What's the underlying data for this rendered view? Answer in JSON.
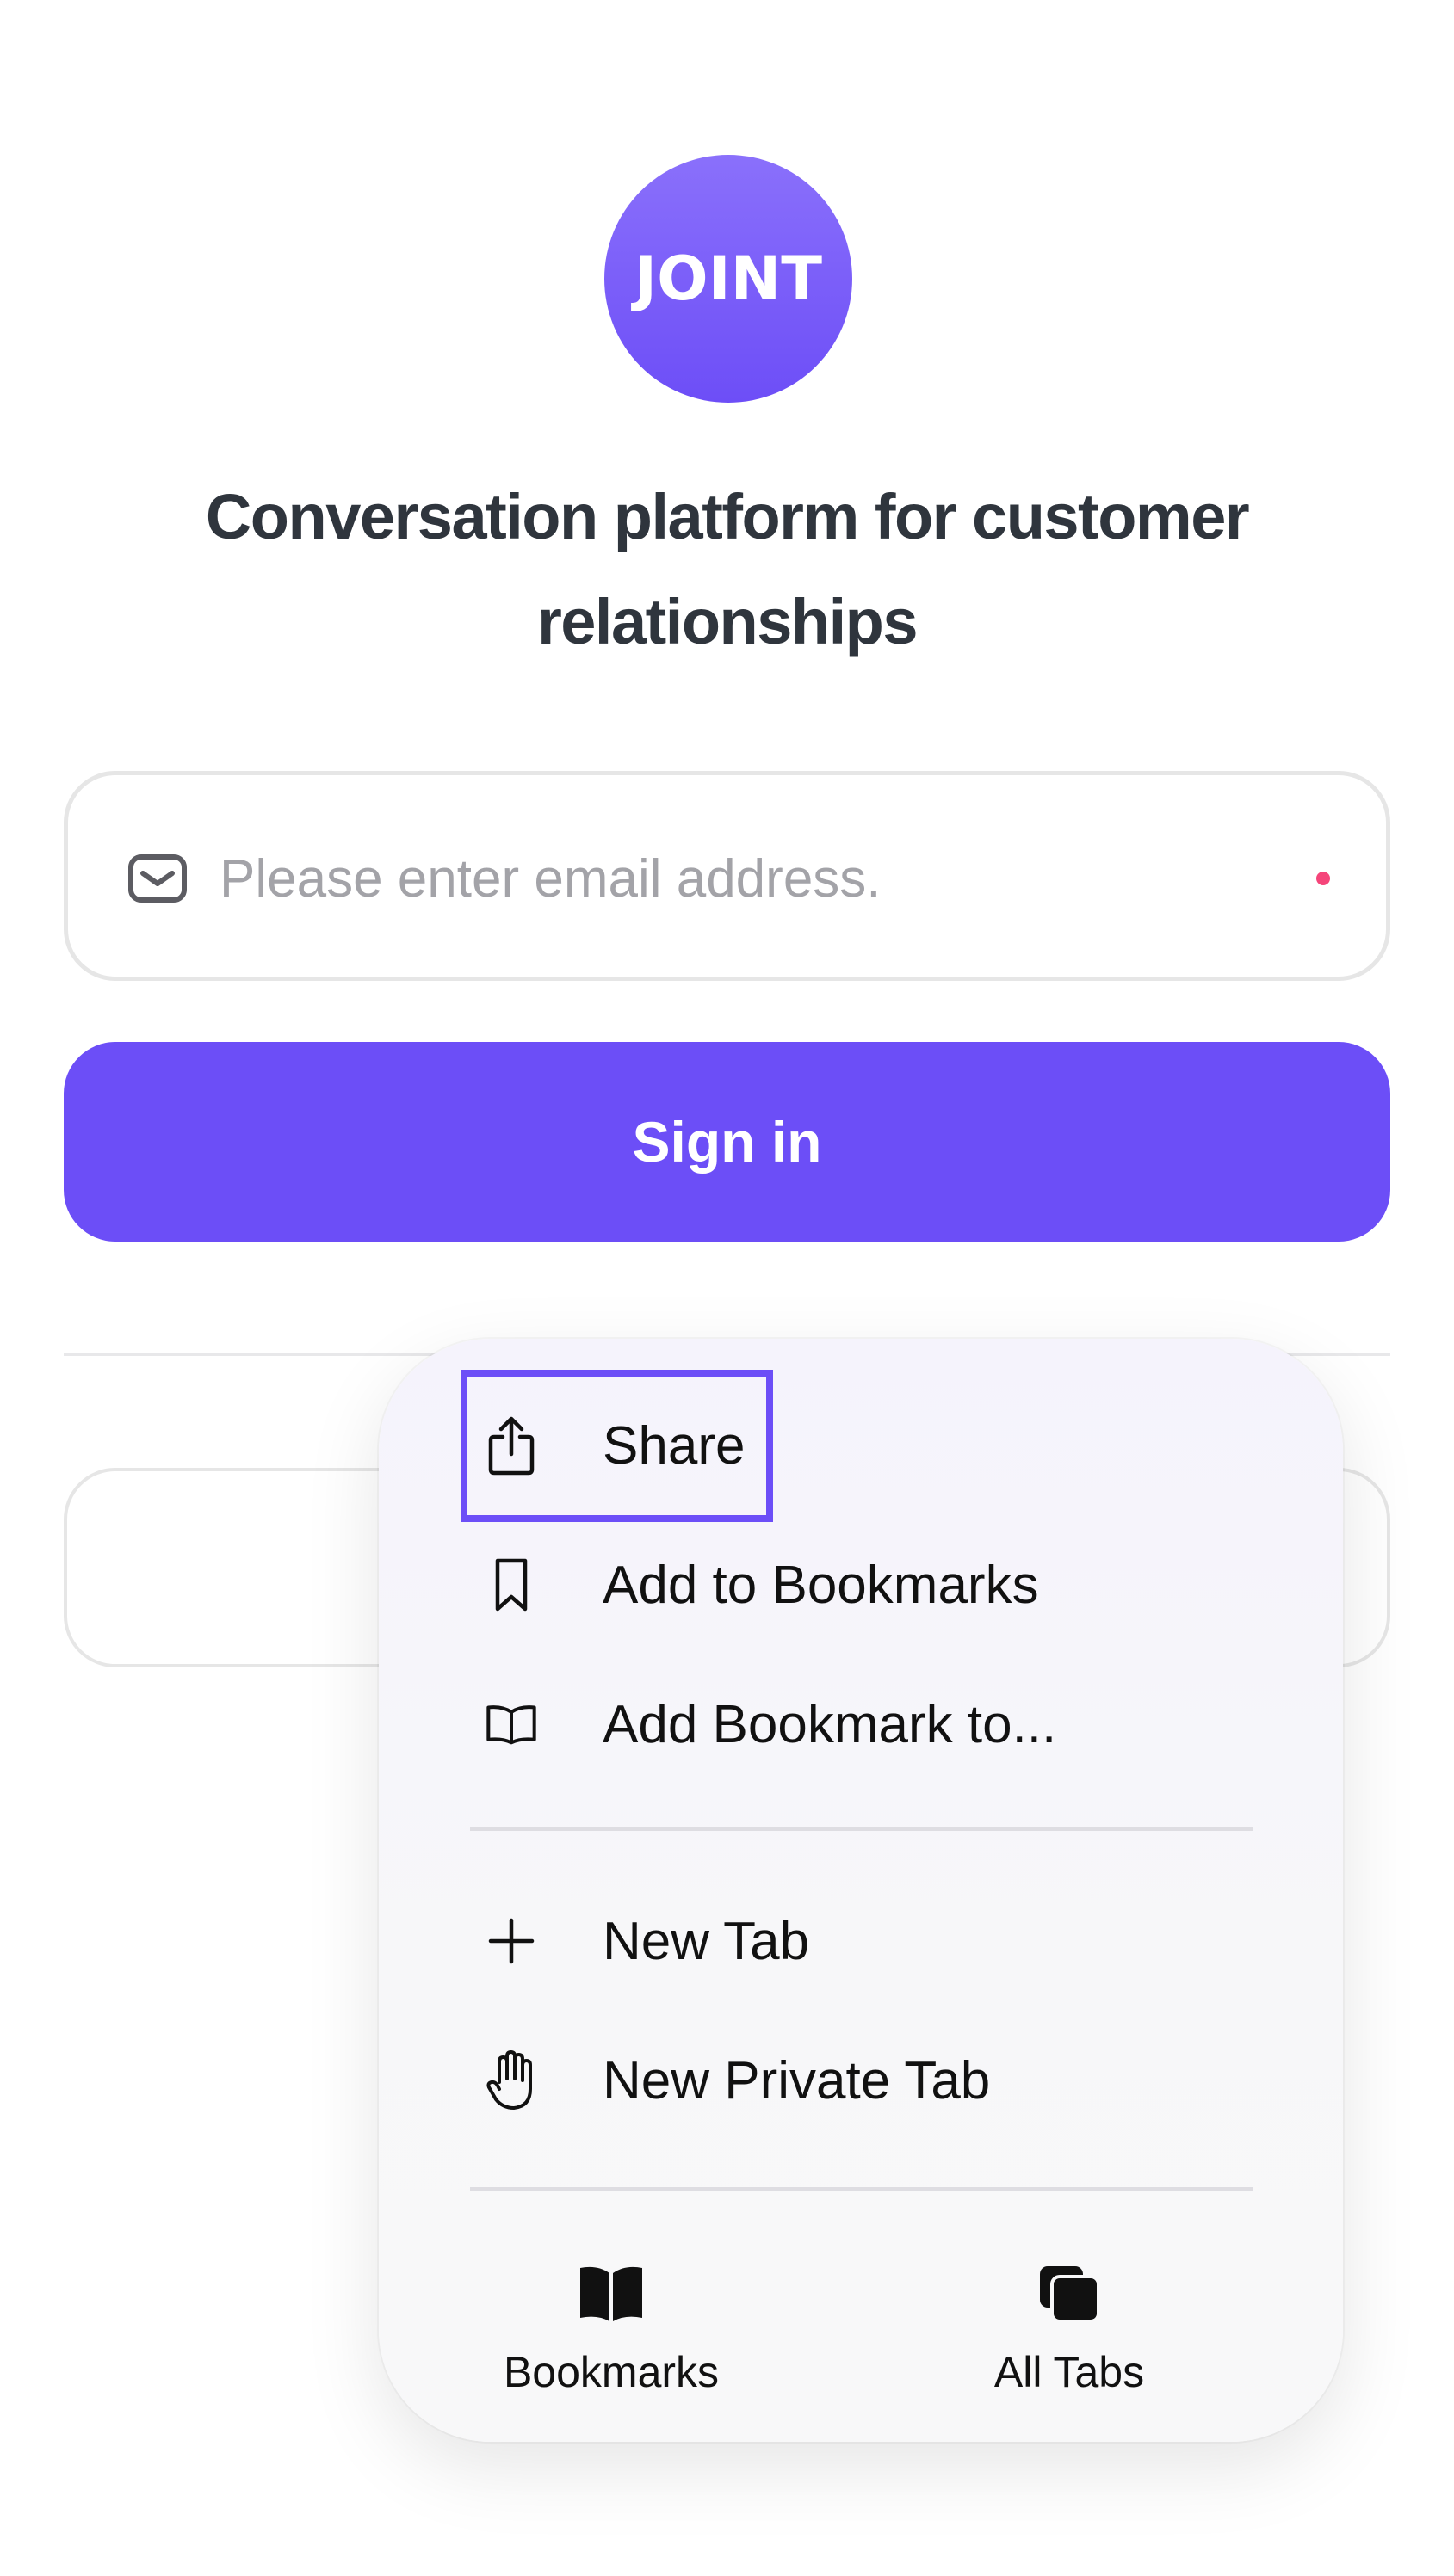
{
  "logo": {
    "text": "JOINT"
  },
  "headline": "Conversation platform for customer relationships",
  "email": {
    "placeholder": "Please enter email address.",
    "value": ""
  },
  "signin": {
    "label": "Sign in"
  },
  "colors": {
    "accent": "#6c4ef7",
    "required_dot": "#f5457a",
    "text": "#2f353d"
  },
  "context_menu": {
    "items": [
      {
        "label": "Share",
        "icon": "share-icon"
      },
      {
        "label": "Add to Bookmarks",
        "icon": "bookmark-icon"
      },
      {
        "label": "Add Bookmark to...",
        "icon": "open-book-icon"
      },
      {
        "label": "New Tab",
        "icon": "plus-icon"
      },
      {
        "label": "New Private Tab",
        "icon": "hand-icon"
      }
    ],
    "bottom": [
      {
        "label": "Bookmarks",
        "icon": "bookmarks-book-icon"
      },
      {
        "label": "All Tabs",
        "icon": "tabs-stack-icon"
      }
    ]
  }
}
